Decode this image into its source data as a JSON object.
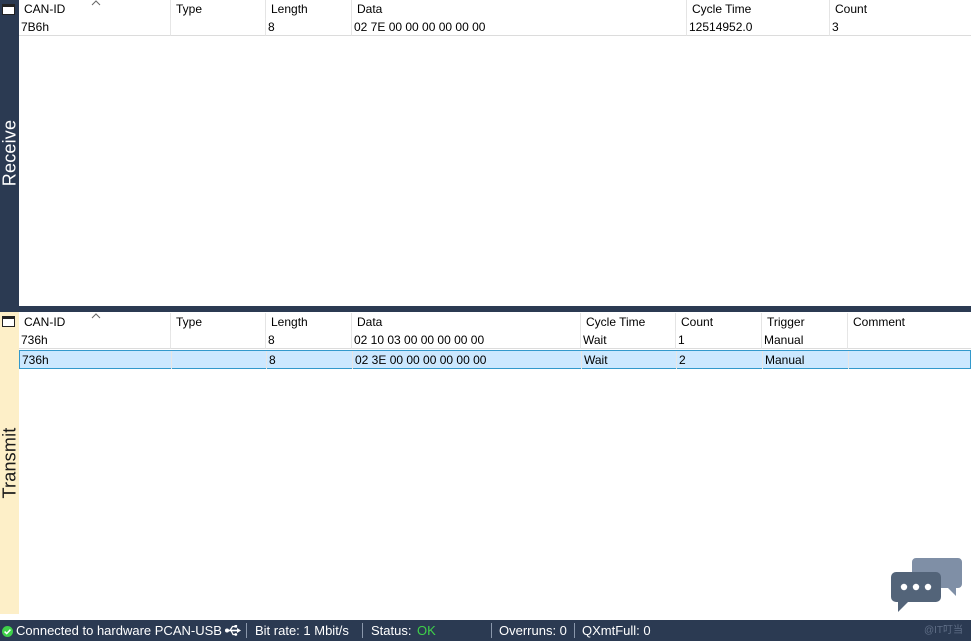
{
  "receive": {
    "label": "Receive",
    "columns": [
      "CAN-ID",
      "Type",
      "Length",
      "Data",
      "Cycle Time",
      "Count"
    ],
    "rows": [
      [
        "7B6h",
        "",
        "8",
        "02 7E 00 00 00 00 00 00",
        "12514952.0",
        "3"
      ]
    ]
  },
  "transmit": {
    "label": "Transmit",
    "columns": [
      "CAN-ID",
      "Type",
      "Length",
      "Data",
      "Cycle Time",
      "Count",
      "Trigger",
      "Comment"
    ],
    "rows": [
      [
        "736h",
        "",
        "8",
        "02 10 03 00 00 00 00 00",
        "Wait",
        "1",
        "Manual",
        ""
      ],
      [
        "736h",
        "",
        "8",
        "02 3E 00 00 00 00 00 00",
        "Wait",
        "2",
        "Manual",
        ""
      ]
    ],
    "selected_row": 1
  },
  "statusbar": {
    "connection": "Connected to hardware PCAN-USB",
    "bitrate": "Bit rate: 1 Mbit/s",
    "status_label": "Status:",
    "status_value": "OK",
    "overruns": "Overruns: 0",
    "qxmtfull": "QXmtFull: 0",
    "watermark": "@IT叮当"
  },
  "colors": {
    "panel_dark": "#2b3a52",
    "transmit_side": "#fdefc8",
    "selection": "#cce8ff",
    "status_ok": "#3fd04a"
  }
}
